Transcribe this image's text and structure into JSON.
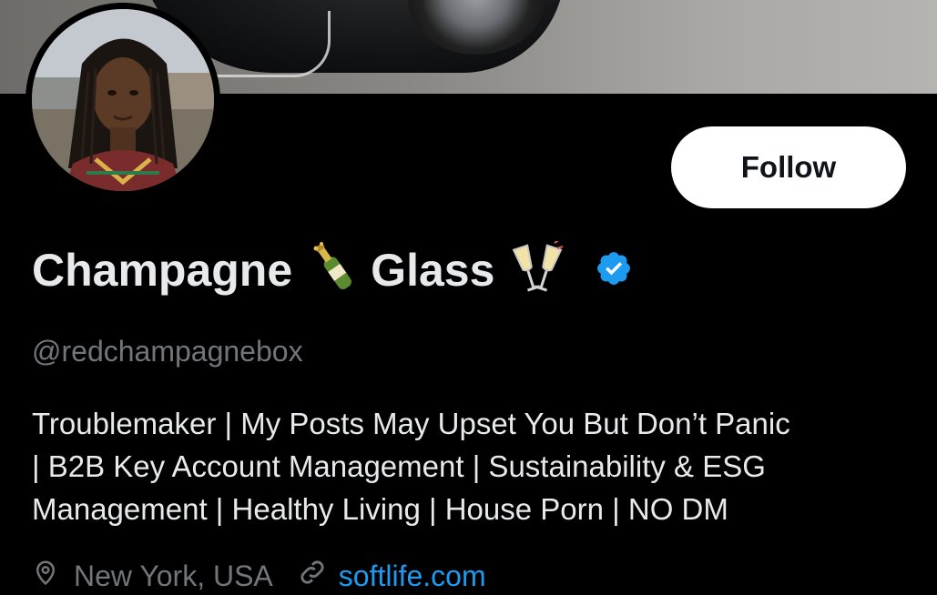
{
  "profile": {
    "name_part1": "Champagne",
    "name_part2": "Glass",
    "emoji_1": "champagne-bottle-icon",
    "emoji_2": "clinking-glasses-icon",
    "verified_icon": "verified-badge-icon",
    "handle": "@redchampagnebox",
    "bio_lines": [
      "Troublemaker | My Posts May Upset You But Don’t Panic",
      "| B2B Key Account Management | Sustainability & ESG",
      "Management | Healthy Living | House Porn | NO DM"
    ],
    "location": "New York, USA",
    "link": "softlife.com"
  },
  "actions": {
    "follow_label": "Follow"
  },
  "colors": {
    "background": "#000000",
    "primary_text": "#e7e9ea",
    "secondary_text": "#71767b",
    "link": "#1d9bf0",
    "verified": "#1d9bf0",
    "follow_button_bg": "#ffffff",
    "follow_button_text": "#0f1419"
  }
}
